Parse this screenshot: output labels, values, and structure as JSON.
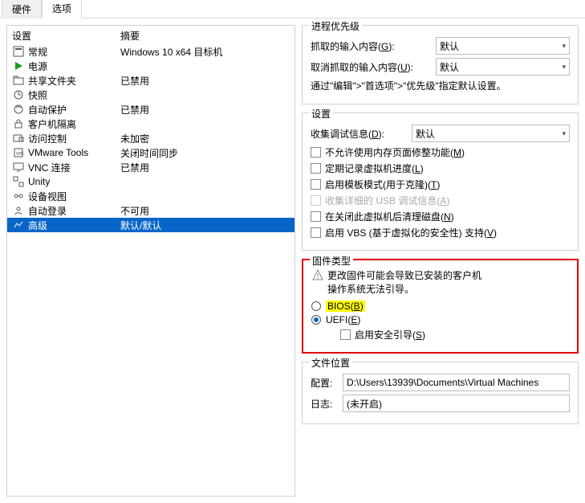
{
  "tabs": {
    "hardware": "硬件",
    "options": "选项"
  },
  "left": {
    "header_setting": "设置",
    "header_summary": "摘要",
    "rows": [
      {
        "label": "常规",
        "summary": "Windows 10 x64 目标机"
      },
      {
        "label": "电源",
        "summary": ""
      },
      {
        "label": "共享文件夹",
        "summary": "已禁用"
      },
      {
        "label": "快照",
        "summary": ""
      },
      {
        "label": "自动保护",
        "summary": "已禁用"
      },
      {
        "label": "客户机隔离",
        "summary": ""
      },
      {
        "label": "访问控制",
        "summary": "未加密"
      },
      {
        "label": "VMware Tools",
        "summary": "关闭时间同步"
      },
      {
        "label": "VNC 连接",
        "summary": "已禁用"
      },
      {
        "label": "Unity",
        "summary": ""
      },
      {
        "label": "设备视图",
        "summary": ""
      },
      {
        "label": "自动登录",
        "summary": "不可用"
      },
      {
        "label": "高级",
        "summary": "默认/默认"
      }
    ]
  },
  "priority": {
    "title": "进程优先级",
    "grab_label_pre": "抓取的输入内容(",
    "grab_label_acc": "G",
    "grab_label_post": "):",
    "ungrab_label_pre": "取消抓取的输入内容(",
    "ungrab_label_acc": "U",
    "ungrab_label_post": "):",
    "default_value": "默认",
    "hint": "通过\"编辑\">\"首选项\">\"优先级\"指定默认设置。"
  },
  "settings": {
    "title": "设置",
    "collect_label_pre": "收集调试信息(",
    "collect_label_acc": "D",
    "collect_label_post": "):",
    "collect_value": "默认",
    "chk1_pre": "不允许使用内存页面修整功能(",
    "chk1_acc": "M",
    "chk1_post": ")",
    "chk2_pre": "定期记录虚拟机进度(",
    "chk2_acc": "L",
    "chk2_post": ")",
    "chk3_pre": "启用模板模式(用于克隆)(",
    "chk3_acc": "T",
    "chk3_post": ")",
    "chk4_pre": "收集详细的 USB 调试信息(",
    "chk4_acc": "A",
    "chk4_post": ")",
    "chk5_pre": "在关闭此虚拟机后清理磁盘(",
    "chk5_acc": "N",
    "chk5_post": ")",
    "chk6_pre": "启用 VBS (基于虚拟化的安全性) 支持(",
    "chk6_acc": "V",
    "chk6_post": ")"
  },
  "firmware": {
    "title": "固件类型",
    "warn1": "更改固件可能会导致已安装的客户机",
    "warn2": "操作系统无法引导。",
    "bios_pre": "BIOS(",
    "bios_acc": "B",
    "bios_post": ")",
    "uefi_pre": "UEFI(",
    "uefi_acc": "E",
    "uefi_post": ")",
    "secure_pre": "启用安全引导(",
    "secure_acc": "S",
    "secure_post": ")"
  },
  "filelocation": {
    "title": "文件位置",
    "config_label": "配置:",
    "config_value": "D:\\Users\\13939\\Documents\\Virtual Machines",
    "log_label": "日志:",
    "log_value": "(未开启)"
  }
}
